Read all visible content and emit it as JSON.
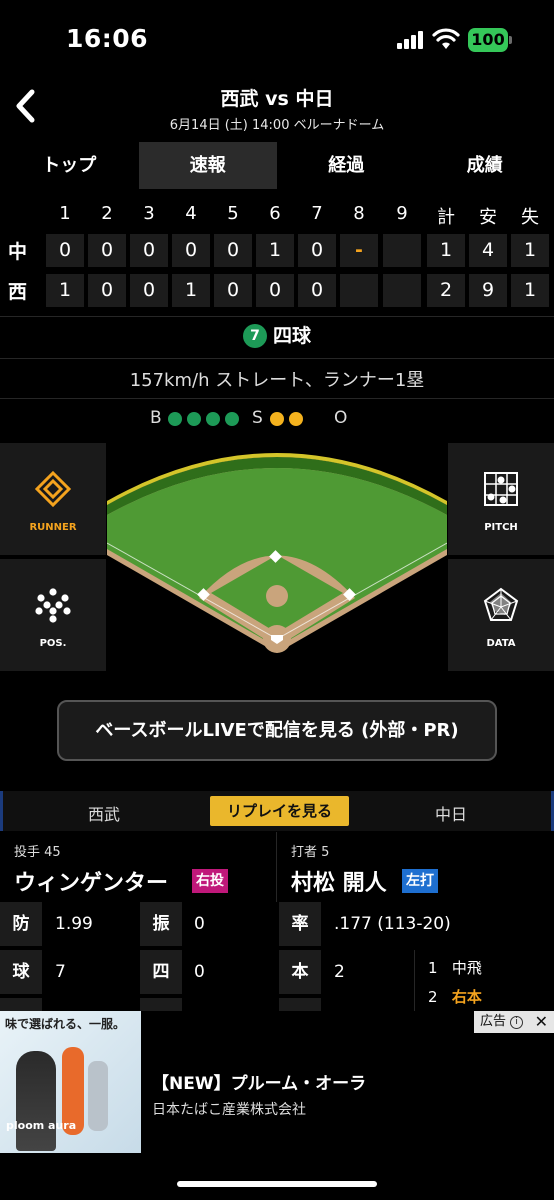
{
  "status": {
    "time": "16:06",
    "battery": "100"
  },
  "nav": {
    "title": "西武 vs 中日",
    "subtitle": "6月14日 (土) 14:00 ベルーナドーム"
  },
  "tabs": [
    {
      "label": "トップ"
    },
    {
      "label": "速報"
    },
    {
      "label": "経過"
    },
    {
      "label": "成績"
    }
  ],
  "scoreboard": {
    "headers": [
      "1",
      "2",
      "3",
      "4",
      "5",
      "6",
      "7",
      "8",
      "9",
      "計",
      "安",
      "失"
    ],
    "rows": [
      {
        "team": "中",
        "innings": [
          "0",
          "0",
          "0",
          "0",
          "0",
          "1",
          "0",
          "-",
          ""
        ],
        "totals": [
          "1",
          "4",
          "1"
        ]
      },
      {
        "team": "西",
        "innings": [
          "1",
          "0",
          "0",
          "1",
          "0",
          "0",
          "0",
          "",
          ""
        ],
        "totals": [
          "2",
          "9",
          "1"
        ]
      }
    ]
  },
  "play": {
    "number": "7",
    "result": "四球",
    "description": "157km/h ストレート、ランナー1塁"
  },
  "count": {
    "b_label": "B",
    "s_label": "S",
    "o_label": "O",
    "balls": 4,
    "strikes": 2,
    "outs": 0
  },
  "side_buttons": {
    "runner": "RUNNER",
    "pitch": "PITCH",
    "pos": "POS.",
    "data": "DATA"
  },
  "live_button": "ベースボールLIVEで配信を見る (外部・PR)",
  "team_bar": {
    "left": "西武",
    "replay": "リプレイを見る",
    "right": "中日"
  },
  "pitcher": {
    "role": "投手 45",
    "name": "ウィンゲンター",
    "hand": "右投"
  },
  "batter": {
    "role": "打者 5",
    "name": "村松 開人",
    "hand": "左打"
  },
  "pitcher_stats": [
    {
      "k": "防",
      "v": "1.99"
    },
    {
      "k": "振",
      "v": "0"
    },
    {
      "k": "球",
      "v": "7"
    },
    {
      "k": "四",
      "v": "0"
    }
  ],
  "batter_stats": [
    {
      "k": "率",
      "v": ".177 (113-20)"
    },
    {
      "k": "本",
      "v": "2"
    }
  ],
  "at_bats": [
    {
      "n": "1",
      "r": "中飛"
    },
    {
      "n": "2",
      "r": "右本"
    }
  ],
  "colors": {
    "ball": "#1d9a57",
    "strike": "#f4b21e",
    "accent_orange": "#f4a31e",
    "pitcher_badge": "#c0187a",
    "batter_badge": "#1e6fd0"
  },
  "ad": {
    "image_caption": "味で選ばれる、一服。",
    "brand": "ploom aura",
    "tag": "広告",
    "title": "【NEW】プルーム・オーラ",
    "sponsor": "日本たばこ産業株式会社"
  }
}
